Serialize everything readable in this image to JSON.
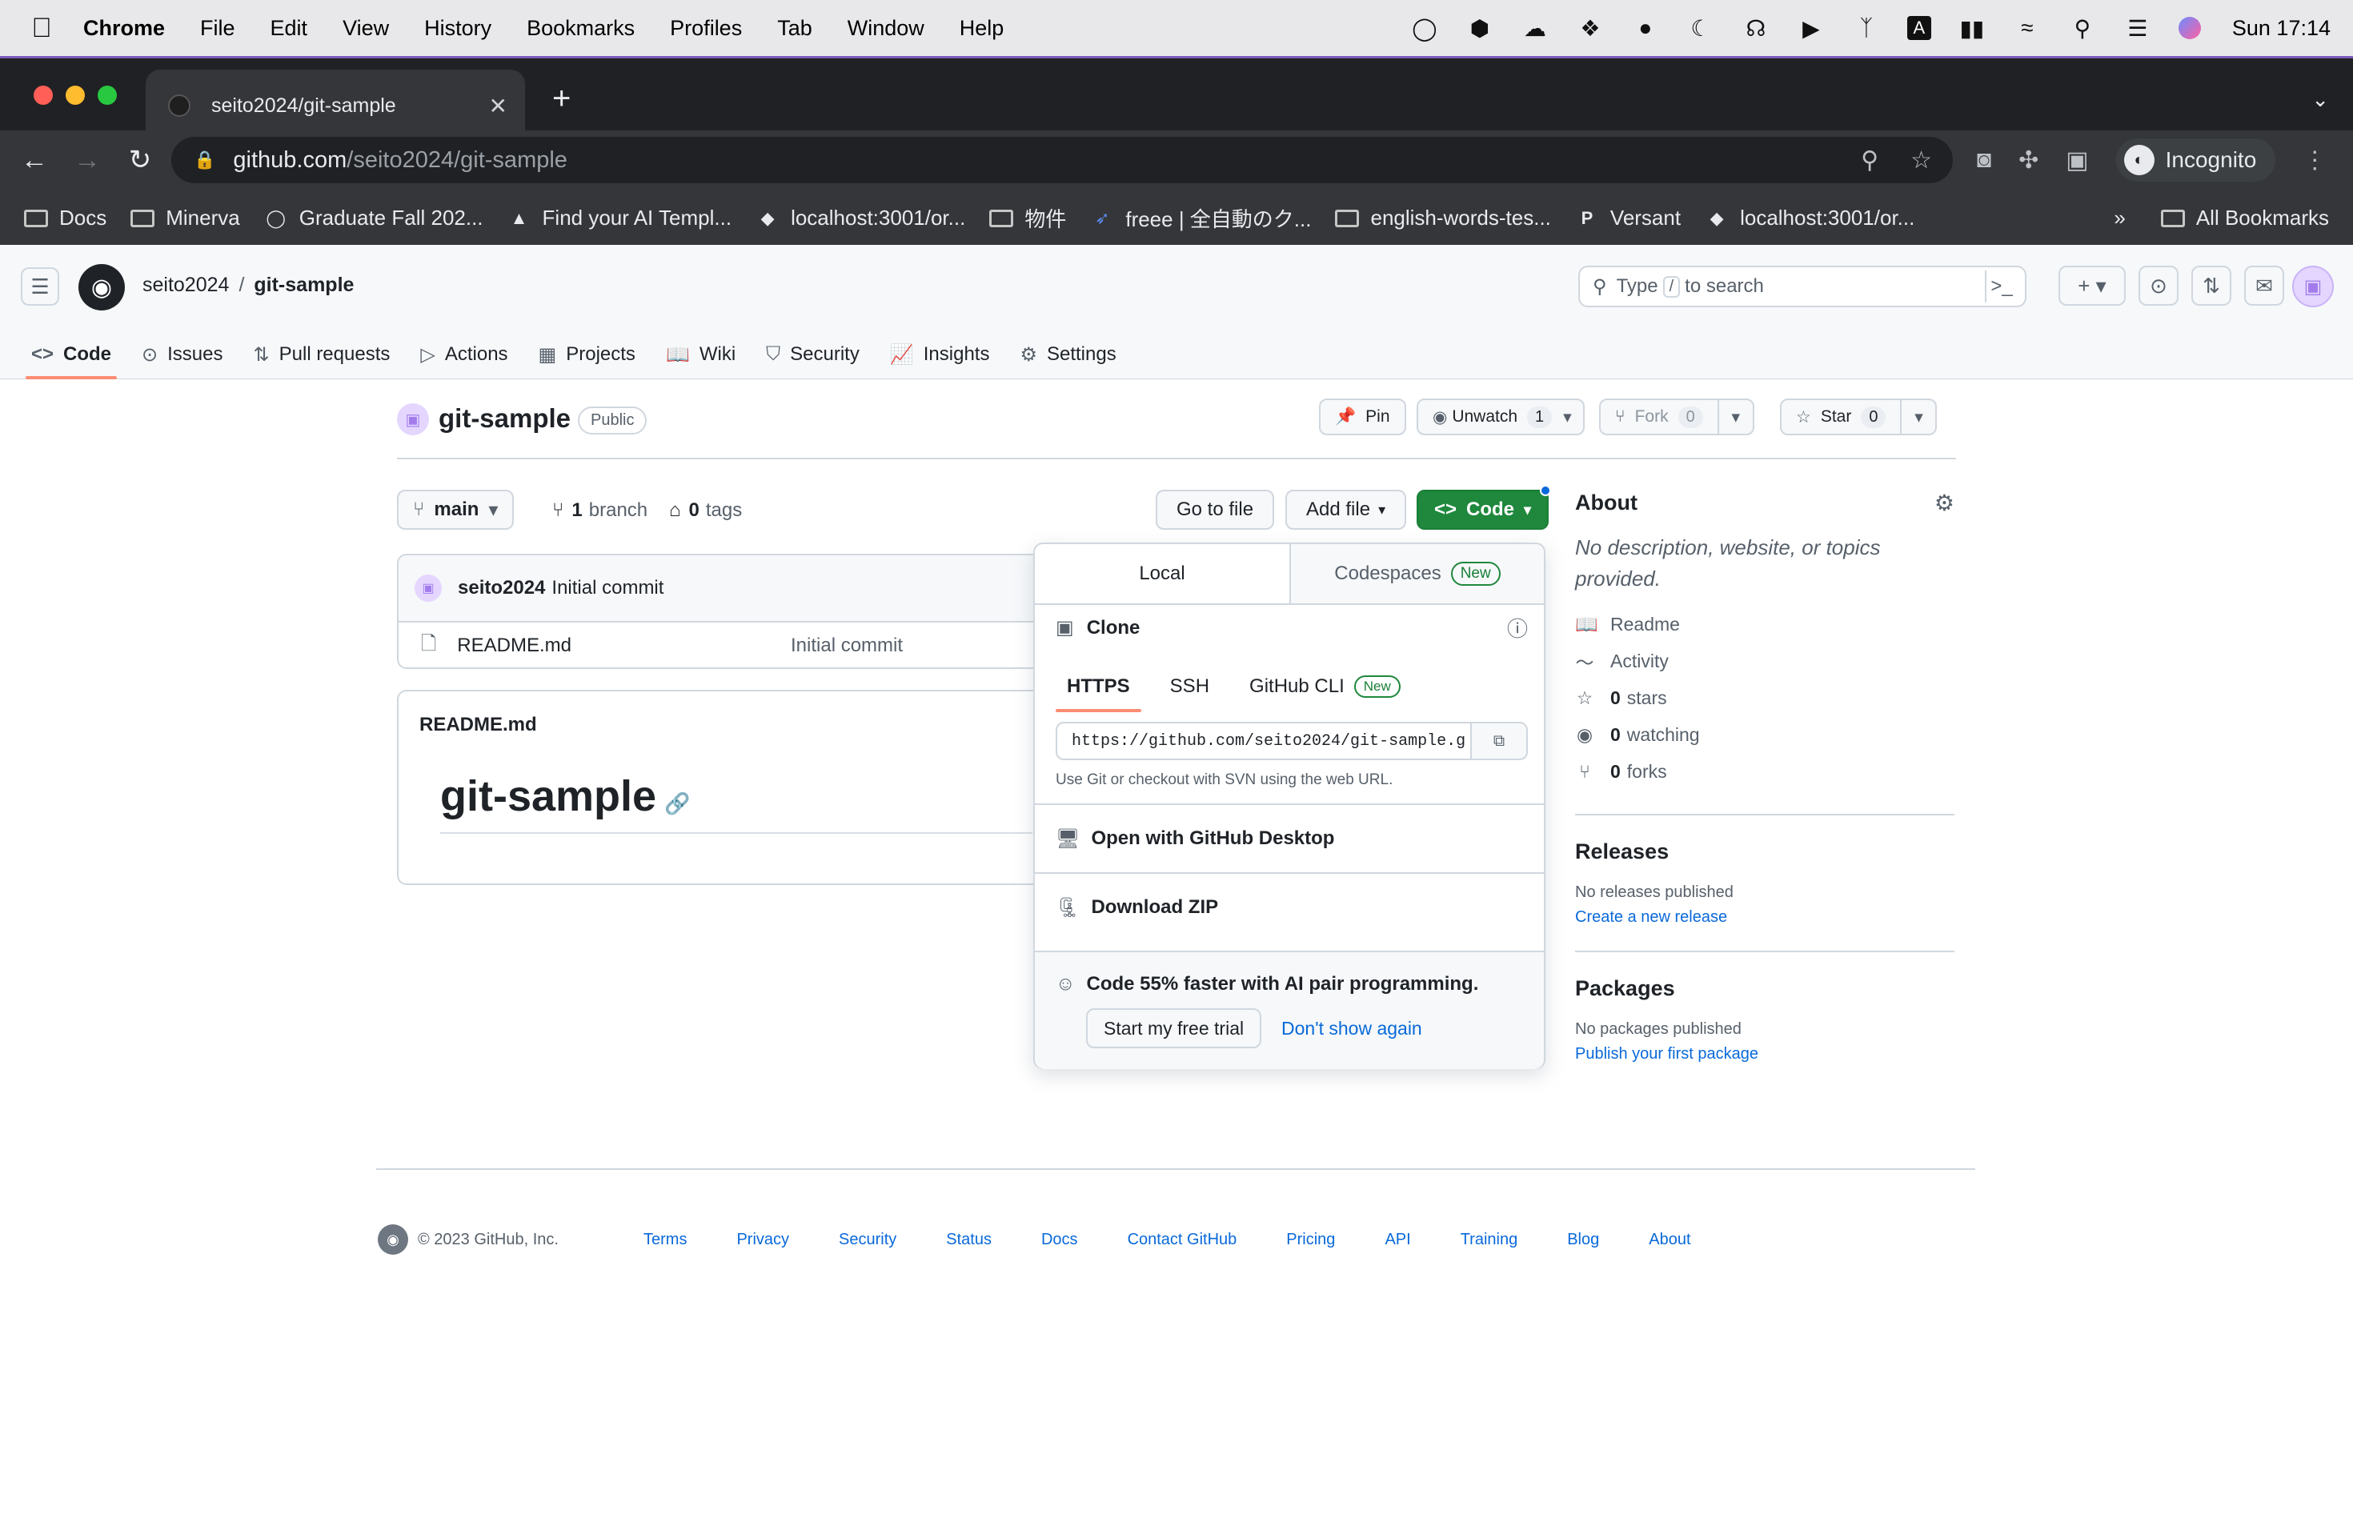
{
  "menubar": {
    "app": "Chrome",
    "items": [
      "File",
      "Edit",
      "View",
      "History",
      "Bookmarks",
      "Profiles",
      "Tab",
      "Window",
      "Help"
    ],
    "clock": "Sun  17:14",
    "status_icons": [
      "1password-icon",
      "shield-icon",
      "creative-cloud-icon",
      "dropbox-icon",
      "evernote-icon",
      "moon-icon",
      "headphones-icon",
      "play-icon",
      "bluetooth-icon",
      "keyboard-a-icon",
      "battery-icon",
      "wifi-icon",
      "spotlight-icon",
      "control-center-icon",
      "siri-icon"
    ]
  },
  "browser": {
    "tab_title": "seito2024/git-sample",
    "url_domain": "github.com",
    "url_path": "/seito2024/git-sample",
    "profile": "Incognito",
    "bookmarks": [
      {
        "label": "Docs",
        "icon": "folder"
      },
      {
        "label": "Minerva",
        "icon": "folder"
      },
      {
        "label": "Graduate Fall 202...",
        "icon": "circle"
      },
      {
        "label": "Find your AI Templ...",
        "icon": "triangle"
      },
      {
        "label": "localhost:3001/or...",
        "icon": "leaf"
      },
      {
        "label": "物件",
        "icon": "folder"
      },
      {
        "label": "freee | 全自動のク...",
        "icon": "bird"
      },
      {
        "label": "english-words-tes...",
        "icon": "folder"
      },
      {
        "label": "Versant",
        "icon": "P"
      },
      {
        "label": "localhost:3001/or...",
        "icon": "leaf"
      }
    ],
    "all_bookmarks": "All Bookmarks",
    "overflow": "»"
  },
  "header": {
    "owner": "seito2024",
    "repo": "git-sample",
    "search_prefix": "Type",
    "search_key": "/",
    "search_suffix": "to search"
  },
  "repo_nav": [
    {
      "label": "Code",
      "icon": "<>",
      "selected": true
    },
    {
      "label": "Issues",
      "icon": "⊙"
    },
    {
      "label": "Pull requests",
      "icon": "⇅"
    },
    {
      "label": "Actions",
      "icon": "▷"
    },
    {
      "label": "Projects",
      "icon": "▦"
    },
    {
      "label": "Wiki",
      "icon": "📖"
    },
    {
      "label": "Security",
      "icon": "⛉"
    },
    {
      "label": "Insights",
      "icon": "📈"
    },
    {
      "label": "Settings",
      "icon": "⚙"
    }
  ],
  "repo": {
    "name": "git-sample",
    "visibility": "Public",
    "pin": "Pin",
    "unwatch": "Unwatch",
    "unwatch_count": "1",
    "fork": "Fork",
    "fork_count": "0",
    "star": "Star",
    "star_count": "0",
    "branch_select": "main",
    "branch_count": "1",
    "branch_label": "branch",
    "tag_count": "0",
    "tag_label": "tags",
    "go_to_file": "Go to file",
    "add_file": "Add file",
    "code": "Code"
  },
  "commit": {
    "author": "seito2024",
    "message": "Initial commit"
  },
  "files": [
    {
      "name": "README.md",
      "message": "Initial commit"
    }
  ],
  "readme": {
    "filename": "README.md",
    "title": "git-sample"
  },
  "dropdown": {
    "tab_local": "Local",
    "tab_codespaces": "Codespaces",
    "new_badge": "New",
    "clone_label": "Clone",
    "subtabs": [
      "HTTPS",
      "SSH",
      "GitHub CLI"
    ],
    "clone_url": "https://github.com/seito2024/git-sample.g",
    "hint": "Use Git or checkout with SVN using the web URL.",
    "open_desktop": "Open with GitHub Desktop",
    "download_zip": "Download ZIP",
    "promo": "Code 55% faster with AI pair programming.",
    "trial_button": "Start my free trial",
    "dismiss_link": "Don't show again"
  },
  "about": {
    "heading": "About",
    "description": "No description, website, or topics provided.",
    "readme": "Readme",
    "activity": "Activity",
    "stars_count": "0",
    "stars_label": "stars",
    "watching_count": "0",
    "watching_label": "watching",
    "forks_count": "0",
    "forks_label": "forks",
    "releases_heading": "Releases",
    "releases_none": "No releases published",
    "releases_link": "Create a new release",
    "packages_heading": "Packages",
    "packages_none": "No packages published",
    "packages_link": "Publish your first package"
  },
  "footer": {
    "copyright": "© 2023 GitHub, Inc.",
    "links": [
      "Terms",
      "Privacy",
      "Security",
      "Status",
      "Docs",
      "Contact GitHub",
      "Pricing",
      "API",
      "Training",
      "Blog",
      "About"
    ]
  },
  "colors": {
    "accent_green": "#1f883d",
    "link_blue": "#0969da",
    "tab_underline": "#fd8c73"
  }
}
